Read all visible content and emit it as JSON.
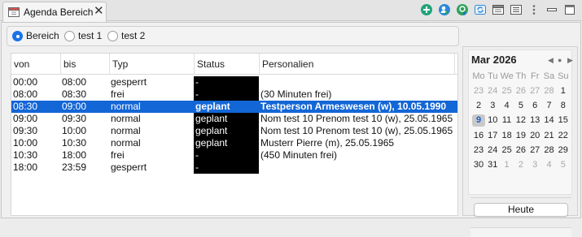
{
  "tab": {
    "title": "Agenda Bereich",
    "close": "✕"
  },
  "toolbar": {
    "buttons": [
      {
        "icon": "add-icon",
        "color": "#21a37a"
      },
      {
        "icon": "add-user-icon",
        "color": "#2a88d8"
      },
      {
        "icon": "add-appointment-icon",
        "color": "#2fa35c"
      },
      {
        "icon": "refresh-icon",
        "color": "#2a88d8"
      },
      {
        "icon": "print-icon",
        "color": "#555555"
      },
      {
        "icon": "list-icon",
        "color": "#555555"
      },
      {
        "icon": "more-icon",
        "color": "#666666"
      },
      {
        "icon": "minimize-icon",
        "color": "#555555"
      },
      {
        "icon": "maximize-icon",
        "color": "#555555"
      }
    ]
  },
  "radios": [
    {
      "label": "Bereich",
      "checked": true
    },
    {
      "label": "test 1",
      "checked": false
    },
    {
      "label": "test 2",
      "checked": false
    }
  ],
  "table": {
    "columns": [
      "von",
      "bis",
      "Typ",
      "Status",
      "Personalien"
    ],
    "rows": [
      {
        "von": "00:00",
        "bis": "08:00",
        "typ": "gesperrt",
        "status": "-",
        "personalien": "",
        "selected": false
      },
      {
        "von": "08:00",
        "bis": "08:30",
        "typ": "frei",
        "status": "-",
        "personalien": "(30 Minuten frei)",
        "selected": false
      },
      {
        "von": "08:30",
        "bis": "09:00",
        "typ": "normal",
        "status": "geplant",
        "personalien": "Testperson Armeswesen (w), 10.05.1990",
        "selected": true
      },
      {
        "von": "09:00",
        "bis": "09:30",
        "typ": "normal",
        "status": "geplant",
        "personalien": "Nom test 10 Prenom test 10 (w), 25.05.1965",
        "selected": false
      },
      {
        "von": "09:30",
        "bis": "10:00",
        "typ": "normal",
        "status": "geplant",
        "personalien": "Nom test 10 Prenom test 10 (w), 25.05.1965",
        "selected": false
      },
      {
        "von": "10:00",
        "bis": "10:30",
        "typ": "normal",
        "status": "geplant",
        "personalien": "Musterr Pierre (m), 25.05.1965",
        "selected": false
      },
      {
        "von": "10:30",
        "bis": "18:00",
        "typ": "frei",
        "status": "-",
        "personalien": "(450 Minuten frei)",
        "selected": false
      },
      {
        "von": "18:00",
        "bis": "23:59",
        "typ": "gesperrt",
        "status": "-",
        "personalien": "",
        "selected": false
      }
    ]
  },
  "calendar": {
    "title": "Mar 2026",
    "prev": "◀",
    "today_dot": "●",
    "next": "▶",
    "weekdays": [
      "Mo",
      "Tu",
      "We",
      "Th",
      "Fr",
      "Sa",
      "Su"
    ],
    "weeks": [
      [
        {
          "d": "23",
          "m": true
        },
        {
          "d": "24",
          "m": true
        },
        {
          "d": "25",
          "m": true
        },
        {
          "d": "26",
          "m": true
        },
        {
          "d": "27",
          "m": true
        },
        {
          "d": "28",
          "m": true
        },
        {
          "d": "1",
          "m": false
        }
      ],
      [
        {
          "d": "2"
        },
        {
          "d": "3"
        },
        {
          "d": "4"
        },
        {
          "d": "5"
        },
        {
          "d": "6"
        },
        {
          "d": "7"
        },
        {
          "d": "8"
        }
      ],
      [
        {
          "d": "9",
          "today": true
        },
        {
          "d": "10"
        },
        {
          "d": "11"
        },
        {
          "d": "12"
        },
        {
          "d": "13"
        },
        {
          "d": "14"
        },
        {
          "d": "15"
        }
      ],
      [
        {
          "d": "16"
        },
        {
          "d": "17"
        },
        {
          "d": "18"
        },
        {
          "d": "19"
        },
        {
          "d": "20"
        },
        {
          "d": "21"
        },
        {
          "d": "22"
        }
      ],
      [
        {
          "d": "23"
        },
        {
          "d": "24"
        },
        {
          "d": "25"
        },
        {
          "d": "26"
        },
        {
          "d": "27"
        },
        {
          "d": "28"
        },
        {
          "d": "29"
        }
      ],
      [
        {
          "d": "30"
        },
        {
          "d": "31"
        },
        {
          "d": "1",
          "m": true
        },
        {
          "d": "2",
          "m": true
        },
        {
          "d": "3",
          "m": true
        },
        {
          "d": "4",
          "m": true
        },
        {
          "d": "5",
          "m": true
        }
      ]
    ],
    "today_button": "Heute"
  }
}
